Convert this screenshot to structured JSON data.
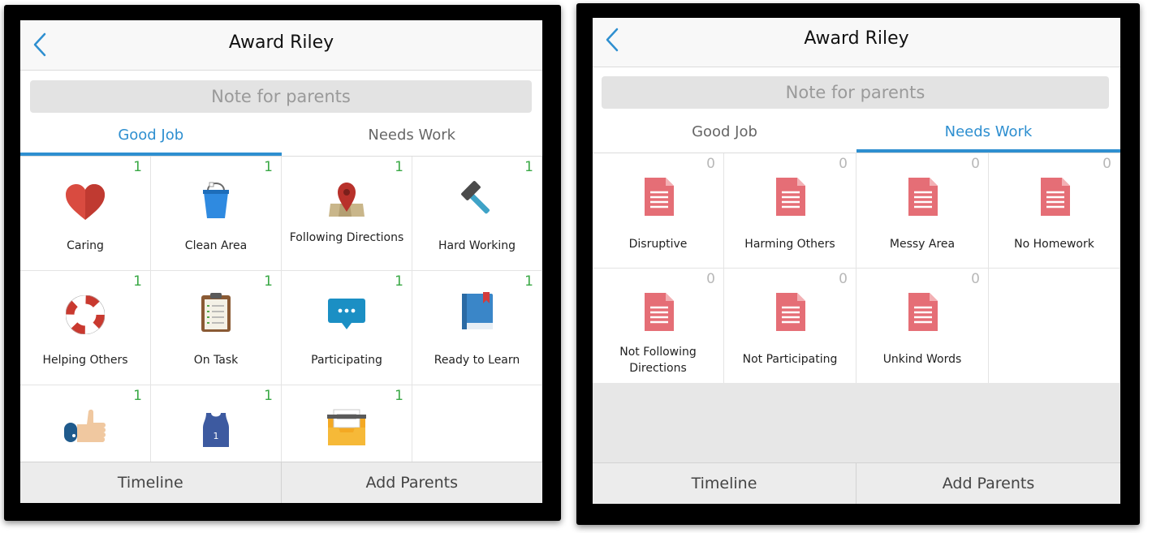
{
  "left_panel": {
    "title": "Award Riley",
    "note_placeholder": "Note for parents",
    "tabs": [
      {
        "label": "Good Job",
        "active": true
      },
      {
        "label": "Needs Work",
        "active": false
      }
    ],
    "behaviors": [
      {
        "label": "Caring",
        "count": "1",
        "icon": "heart-icon"
      },
      {
        "label": "Clean Area",
        "count": "1",
        "icon": "bucket-icon"
      },
      {
        "label": "Following Directions",
        "count": "1",
        "icon": "map-pin-icon"
      },
      {
        "label": "Hard Working",
        "count": "1",
        "icon": "hammer-icon"
      },
      {
        "label": "Helping Others",
        "count": "1",
        "icon": "life-ring-icon"
      },
      {
        "label": "On Task",
        "count": "1",
        "icon": "clipboard-icon"
      },
      {
        "label": "Participating",
        "count": "1",
        "icon": "chat-bubble-icon"
      },
      {
        "label": "Ready to Learn",
        "count": "1",
        "icon": "book-icon"
      },
      {
        "label": "",
        "count": "1",
        "icon": "thumbs-up-icon"
      },
      {
        "label": "",
        "count": "1",
        "icon": "jersey-icon"
      },
      {
        "label": "",
        "count": "1",
        "icon": "inbox-tray-icon"
      }
    ],
    "bottom": {
      "timeline": "Timeline",
      "add_parents": "Add Parents"
    }
  },
  "right_panel": {
    "title": "Award Riley",
    "note_placeholder": "Note for parents",
    "tabs": [
      {
        "label": "Good Job",
        "active": false
      },
      {
        "label": "Needs Work",
        "active": true
      }
    ],
    "behaviors": [
      {
        "label": "Disruptive",
        "count": "0",
        "icon": "document-icon"
      },
      {
        "label": "Harming Others",
        "count": "0",
        "icon": "document-icon"
      },
      {
        "label": "Messy Area",
        "count": "0",
        "icon": "document-icon"
      },
      {
        "label": "No Homework",
        "count": "0",
        "icon": "document-icon"
      },
      {
        "label": "Not Following Directions",
        "count": "0",
        "icon": "document-icon"
      },
      {
        "label": "Not Participating",
        "count": "0",
        "icon": "document-icon"
      },
      {
        "label": "Unkind Words",
        "count": "0",
        "icon": "document-icon"
      }
    ],
    "bottom": {
      "timeline": "Timeline",
      "add_parents": "Add Parents"
    }
  },
  "colors": {
    "accent": "#2e8fd0",
    "positive_count": "#39a845",
    "zero_count": "#b8b8b8",
    "document": "#e56e76"
  }
}
